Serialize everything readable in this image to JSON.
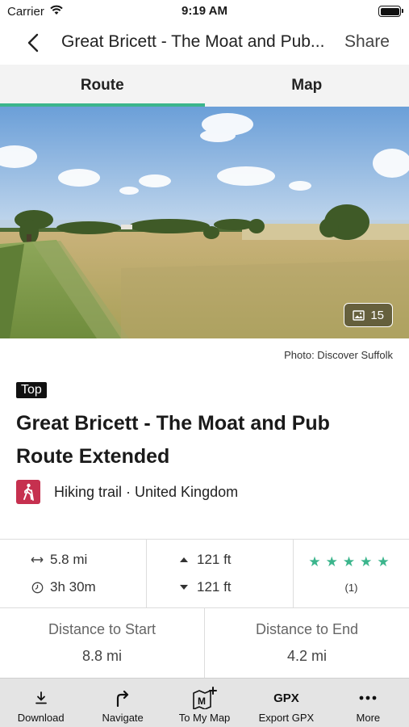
{
  "status_bar": {
    "carrier": "Carrier",
    "time": "9:19 AM"
  },
  "nav": {
    "title": "Great Bricett - The Moat and Pub...",
    "share_label": "Share"
  },
  "tabs": [
    {
      "label": "Route",
      "active": true
    },
    {
      "label": "Map",
      "active": false
    }
  ],
  "hero": {
    "photo_count": "15",
    "photo_credit": "Photo: Discover Suffolk"
  },
  "route": {
    "badge": "Top",
    "title_line1": "Great Bricett - The Moat and Pub",
    "title_line2": "Route Extended",
    "meta": "Hiking trail · United Kingdom",
    "icon": "hiker-icon",
    "accent_color": "#c6304f"
  },
  "stats": {
    "distance": "5.8 mi",
    "duration": "3h 30m",
    "ascent": "121 ft",
    "descent": "121 ft",
    "rating_stars": "★★★★★",
    "rating_value": 5,
    "review_count": "(1)",
    "star_color": "#3bb58c"
  },
  "distances": {
    "start_label": "Distance to Start",
    "start_value": "8.8 mi",
    "end_label": "Distance to End",
    "end_value": "4.2 mi"
  },
  "toolbar": [
    {
      "label": "Download",
      "icon": "download-icon"
    },
    {
      "label": "Navigate",
      "icon": "navigate-icon"
    },
    {
      "label": "To My Map",
      "icon": "add-to-map-icon"
    },
    {
      "label": "Export GPX",
      "icon": "gpx-icon",
      "icon_text": "GPX"
    },
    {
      "label": "More",
      "icon": "more-icon"
    }
  ]
}
